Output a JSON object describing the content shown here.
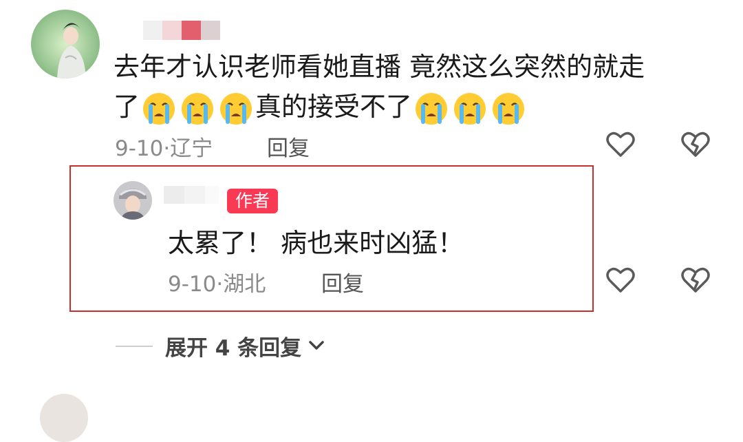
{
  "comment": {
    "text_line1": "去年才认识老师看她直播 竟然这么突然的就走",
    "text_line2_a": "了",
    "text_line2_b": "真的接受不了",
    "emoji_name": "loudly-crying-face",
    "date": "9-10",
    "location": "辽宁",
    "reply_label": "回复"
  },
  "reply": {
    "badge": "作者",
    "text": "太累了！ 病也来时凶猛！",
    "date": "9-10",
    "location": "湖北",
    "reply_label": "回复"
  },
  "expand": {
    "label": "展开 4 条回复"
  },
  "colors": {
    "badge": "#fa3a55",
    "highlight_border": "#c9302c"
  }
}
